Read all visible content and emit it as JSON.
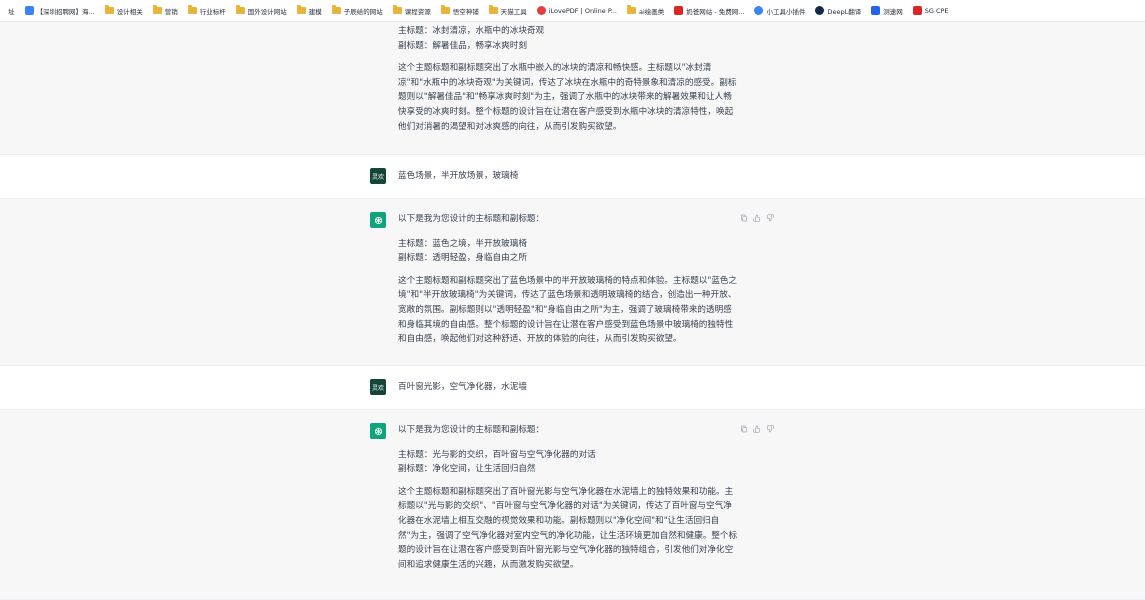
{
  "bookmarks": [
    {
      "label": "址",
      "icon": "text-icon",
      "color": "#6b7280"
    },
    {
      "label": "【深圳招聘网】海...",
      "icon": "page-icon",
      "color": "#3b82f6"
    },
    {
      "label": "设计相关",
      "icon": "folder-icon",
      "color": "#e8b53a"
    },
    {
      "label": "营销",
      "icon": "folder-icon",
      "color": "#e8b53a"
    },
    {
      "label": "行业标杆",
      "icon": "folder-icon",
      "color": "#e8b53a"
    },
    {
      "label": "国外设计网站",
      "icon": "folder-icon",
      "color": "#e8b53a"
    },
    {
      "label": "建模",
      "icon": "folder-icon",
      "color": "#e8b53a"
    },
    {
      "label": "子辰给的网站",
      "icon": "folder-icon",
      "color": "#e8b53a"
    },
    {
      "label": "课程资源",
      "icon": "folder-icon",
      "color": "#e8b53a"
    },
    {
      "label": "悟空神铺",
      "icon": "folder-icon",
      "color": "#e8b53a"
    },
    {
      "label": "天猫工具",
      "icon": "folder-icon",
      "color": "#e8b53a"
    },
    {
      "label": "iLovePDF | Online P...",
      "icon": "heart-icon",
      "color": "#e53e3e"
    },
    {
      "label": "ai绘画类",
      "icon": "folder-icon",
      "color": "#e8b53a"
    },
    {
      "label": "奶爸网站 - 免费网...",
      "icon": "n-logo-icon",
      "color": "#dc2626"
    },
    {
      "label": "小工具小插件",
      "icon": "shield-icon",
      "color": "#3b82f6"
    },
    {
      "label": "DeepL翻译",
      "icon": "deepl-icon",
      "color": "#0f2b46"
    },
    {
      "label": "测速网",
      "icon": "speed-icon",
      "color": "#2563eb"
    },
    {
      "label": "SG CPE",
      "icon": "cpe-icon",
      "color": "#dc2626"
    }
  ],
  "colors": {
    "assistant_bg": "#f7f7f8",
    "gpt_avatar": "#10a37f",
    "user_avatar": "#12463a"
  },
  "messages": [
    {
      "role": "assistant",
      "lines": [
        "主标题：冰封清凉，水瓶中的冰块奇观",
        "副标题：解暑佳品，畅享冰爽时刻"
      ],
      "body": "这个主题标题和副标题突出了水瓶中嵌入的冰块的清凉和畅快感。主标题以\"冰封清凉\"和\"水瓶中的冰块奇观\"为关键词，传达了冰块在水瓶中的奇特景象和清凉的感受。副标题则以\"解暑佳品\"和\"畅享冰爽时刻\"为主，强调了水瓶中的冰块带来的解暑效果和让人畅快享受的冰爽时刻。整个标题的设计旨在让潜在客户感受到水瓶中冰块的清凉特性，唤起他们对消暑的渴望和对冰爽感的向往，从而引发购买欲望。"
    },
    {
      "role": "user",
      "avatar_text": "灵欢",
      "text": "蓝色场景，半开放场景，玻璃椅"
    },
    {
      "role": "assistant",
      "intro": "以下是我为您设计的主标题和副标题：",
      "lines": [
        "主标题：蓝色之境，半开放玻璃椅",
        "副标题：透明轻盈，身临自由之所"
      ],
      "body": "这个主题标题和副标题突出了蓝色场景中的半开放玻璃椅的特点和体验。主标题以\"蓝色之境\"和\"半开放玻璃椅\"为关键词，传达了蓝色场景和透明玻璃椅的结合，创造出一种开放、宽敞的氛围。副标题则以\"透明轻盈\"和\"身临自由之所\"为主，强调了玻璃椅带来的透明感和身临其境的自由感。整个标题的设计旨在让潜在客户感受到蓝色场景中玻璃椅的独特性和自由感，唤起他们对这种舒适、开放的体验的向往，从而引发购买欲望。"
    },
    {
      "role": "user",
      "avatar_text": "灵欢",
      "text": "百叶窗光影，空气净化器，水泥墙"
    },
    {
      "role": "assistant",
      "intro": "以下是我为您设计的主标题和副标题：",
      "lines": [
        "主标题：光与影的交织，百叶窗与空气净化器的对话",
        "副标题：净化空间，让生活回归自然"
      ],
      "body": "这个主题标题和副标题突出了百叶窗光影与空气净化器在水泥墙上的独特效果和功能。主标题以\"光与影的交织\"、\"百叶窗与空气净化器的对话\"为关键词，传达了百叶窗与空气净化器在水泥墙上相互交融的视觉效果和功能。副标题则以\"净化空间\"和\"让生活回归自然\"为主，强调了空气净化器对室内空气的净化功能，让生活环境更加自然和健康。整个标题的设计旨在让潜在客户感受到百叶窗光影与空气净化器的独特组合，引发他们对净化空间和追求健康生活的兴趣，从而激发购买欲望。"
    }
  ]
}
